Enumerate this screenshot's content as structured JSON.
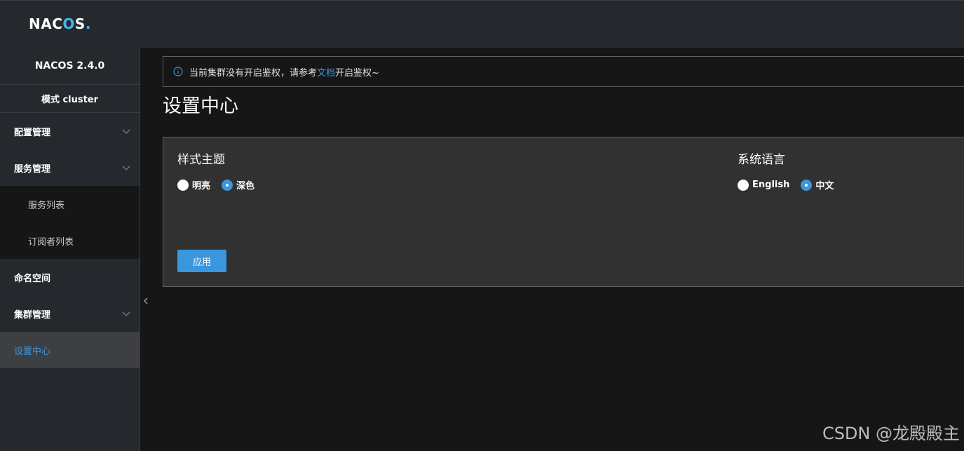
{
  "brand": {
    "logo_prefix": "NAC",
    "logo_o": "O",
    "logo_suffix": "S",
    "logo_dot": "."
  },
  "sidebar": {
    "version": "NACOS 2.4.0",
    "mode": "模式 cluster",
    "items": [
      {
        "label": "配置管理",
        "expandable": true
      },
      {
        "label": "服务管理",
        "expandable": true
      },
      {
        "label": "服务列表",
        "sub": true
      },
      {
        "label": "订阅者列表",
        "sub": true
      },
      {
        "label": "命名空间",
        "expandable": false
      },
      {
        "label": "集群管理",
        "expandable": true
      },
      {
        "label": "设置中心",
        "active": true
      }
    ]
  },
  "notice": {
    "text_before": "当前集群没有开启鉴权，请参考",
    "link": "文档",
    "text_after": "开启鉴权~"
  },
  "page": {
    "title": "设置中心"
  },
  "settings": {
    "theme": {
      "title": "样式主题",
      "options": [
        "明亮",
        "深色"
      ],
      "selected": "深色"
    },
    "language": {
      "title": "系统语言",
      "options": [
        "English",
        "中文"
      ],
      "selected": "中文"
    },
    "apply_label": "应用"
  },
  "watermark": "CSDN @龙殿殿主",
  "colors": {
    "accent": "#3a96dd",
    "header_bg": "#25282d",
    "page_bg": "#161616",
    "panel_bg": "#313131"
  }
}
